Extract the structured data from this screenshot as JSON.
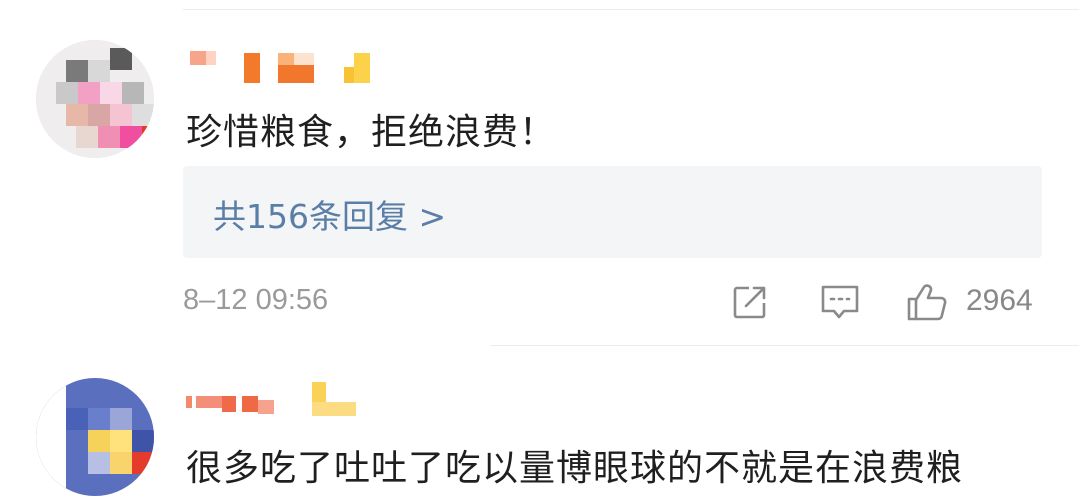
{
  "comments": [
    {
      "text": "珍惜粮食，拒绝浪费！",
      "replies_label": "共156条回复 >",
      "timestamp": "8–12 09:56",
      "likes": "2964",
      "icons": [
        "share-icon",
        "comment-icon",
        "like-icon"
      ]
    },
    {
      "text": "很多吃了吐吐了吃以量博眼球的不就是在浪费粮"
    }
  ]
}
